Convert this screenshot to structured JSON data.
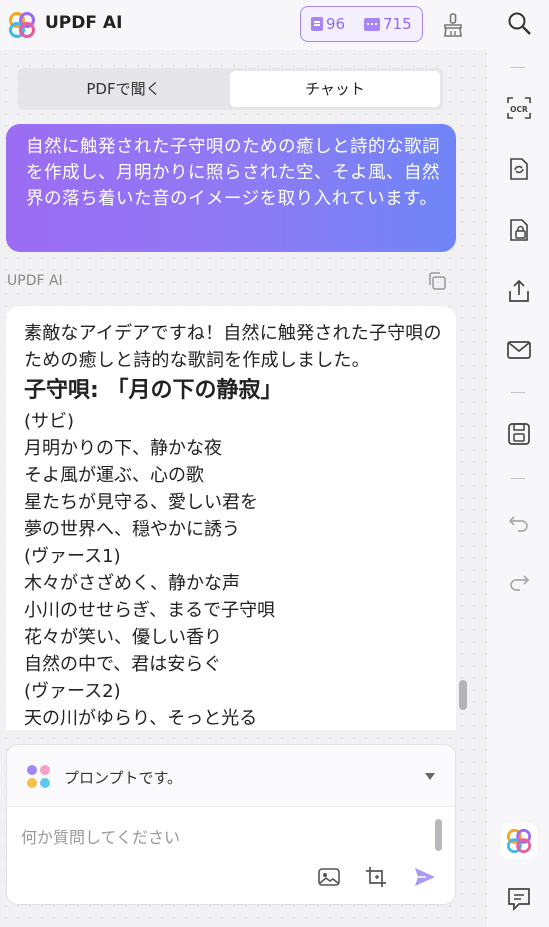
{
  "header": {
    "app_title": "UPDF AI",
    "credits_docs": "96",
    "credits_chat": "715"
  },
  "tabs": [
    {
      "label": "PDFで聞く",
      "active": false
    },
    {
      "label": "チャット",
      "active": true
    }
  ],
  "conversation": {
    "user_message": "自然に触発された子守唄のための癒しと詩的な歌詞を作成し、月明かりに照らされた空、そよ風、自然界の落ち着いた音のイメージを取り入れています。",
    "ai_label": "UPDF AI",
    "answer_intro": "素敵なアイデアですね！自然に触発された子守唄のための癒しと詩的な歌詞を作成しました。",
    "song_title": "子守唄: 「月の下の静寂」",
    "lines": [
      "(サビ)",
      "月明かりの下、静かな夜",
      "そよ風が運ぶ、心の歌",
      "星たちが見守る、愛しい君を",
      "夢の世界へ、穏やかに誘う",
      "(ヴァース1)",
      "木々がさざめく、静かな声",
      "小川のせせらぎ、まるで子守唄",
      "花々が笑い、優しい香り",
      "自然の中で、君は安らぐ",
      "(ヴァース2)",
      "天の川がゆらり、そっと光る"
    ]
  },
  "input": {
    "prompt_label": "プロンプトです。",
    "placeholder": "何か質問してください"
  },
  "colors": {
    "accent": "#9c6cf3",
    "bubble_end": "#6f85f6",
    "send": "#a99af5"
  },
  "sidebar_icons": [
    "search-icon",
    "ocr-icon",
    "convert-icon",
    "protect-icon",
    "share-icon",
    "email-icon",
    "save-icon",
    "undo-icon",
    "redo-icon",
    "updf-ai-icon",
    "comment-icon"
  ]
}
